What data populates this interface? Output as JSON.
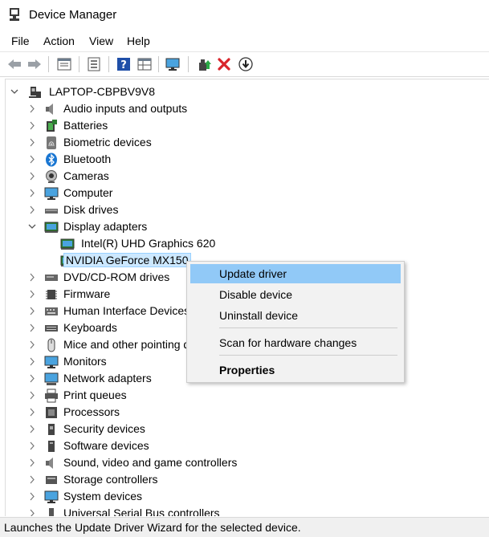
{
  "window": {
    "title": "Device Manager"
  },
  "menu": {
    "items": [
      "File",
      "Action",
      "View",
      "Help"
    ]
  },
  "toolbar": {
    "buttons": [
      "back-icon",
      "forward-icon",
      "properties-icon",
      "list-icon",
      "help-icon",
      "grid-icon",
      "monitor-icon",
      "update-driver-icon",
      "uninstall-icon",
      "download-icon"
    ]
  },
  "tree": {
    "root": "LAPTOP-CBPBV9V8",
    "categories": [
      {
        "label": "Audio inputs and outputs",
        "icon": "speaker-icon"
      },
      {
        "label": "Batteries",
        "icon": "battery-icon"
      },
      {
        "label": "Biometric devices",
        "icon": "fingerprint-icon"
      },
      {
        "label": "Bluetooth",
        "icon": "bluetooth-icon"
      },
      {
        "label": "Cameras",
        "icon": "camera-icon"
      },
      {
        "label": "Computer",
        "icon": "computer-icon"
      },
      {
        "label": "Disk drives",
        "icon": "disk-icon"
      },
      {
        "label": "Display adapters",
        "icon": "display-adapter-icon",
        "expanded": true,
        "children": [
          {
            "label": "Intel(R) UHD Graphics 620",
            "icon": "display-adapter-icon"
          },
          {
            "label": "NVIDIA GeForce MX150",
            "icon": "display-adapter-icon",
            "selected": true
          }
        ]
      },
      {
        "label": "DVD/CD-ROM drives",
        "icon": "dvd-icon"
      },
      {
        "label": "Firmware",
        "icon": "chip-icon"
      },
      {
        "label": "Human Interface Devices",
        "icon": "hid-icon"
      },
      {
        "label": "Keyboards",
        "icon": "keyboard-icon"
      },
      {
        "label": "Mice and other pointing devices",
        "icon": "mouse-icon"
      },
      {
        "label": "Monitors",
        "icon": "monitor-icon"
      },
      {
        "label": "Network adapters",
        "icon": "network-icon"
      },
      {
        "label": "Print queues",
        "icon": "printer-icon"
      },
      {
        "label": "Processors",
        "icon": "processor-icon"
      },
      {
        "label": "Security devices",
        "icon": "security-icon"
      },
      {
        "label": "Software devices",
        "icon": "software-icon"
      },
      {
        "label": "Sound, video and game controllers",
        "icon": "speaker-icon"
      },
      {
        "label": "Storage controllers",
        "icon": "storage-icon"
      },
      {
        "label": "System devices",
        "icon": "computer-icon"
      },
      {
        "label": "Universal Serial Bus controllers",
        "icon": "usb-icon"
      }
    ]
  },
  "context_menu": {
    "items": [
      {
        "label": "Update driver",
        "highlighted": true
      },
      {
        "label": "Disable device"
      },
      {
        "label": "Uninstall device"
      },
      {
        "label": "Scan for hardware changes"
      },
      {
        "label": "Properties",
        "bold": true
      }
    ]
  },
  "status": {
    "text": "Launches the Update Driver Wizard for the selected device."
  },
  "colors": {
    "selection": "#cce8ff",
    "menu_highlight": "#91c9f7",
    "delete_red": "#d9252b"
  }
}
